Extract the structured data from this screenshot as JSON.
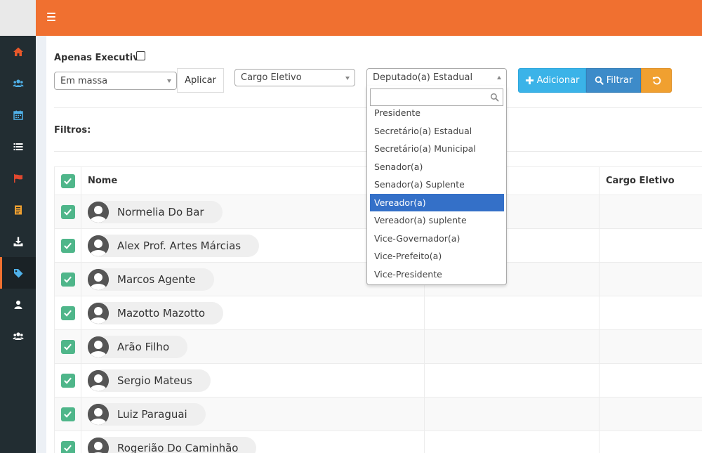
{
  "header": {
    "menu_icon": "hamburger-icon",
    "accent": "#f07030"
  },
  "sidebar": {
    "items": [
      {
        "icon": "home-icon",
        "color": "#e8582a"
      },
      {
        "icon": "users-icon",
        "color": "#4fb0e8"
      },
      {
        "icon": "calendar-icon",
        "color": "#4fb0e8"
      },
      {
        "icon": "list-icon",
        "color": "#ffffff"
      },
      {
        "icon": "flag-icon",
        "color": "#e0482f"
      },
      {
        "icon": "document-icon",
        "color": "#f0a030"
      },
      {
        "icon": "download-icon",
        "color": "#ffffff"
      },
      {
        "icon": "tag-icon",
        "color": "#4fb0e8",
        "active": true
      },
      {
        "icon": "user-icon",
        "color": "#ffffff"
      },
      {
        "icon": "group-icon",
        "color": "#ffffff"
      }
    ]
  },
  "toolbar": {
    "exec_label": "Apenas Executiva",
    "bulk_select": "Em massa",
    "apply_label": "Aplicar",
    "cargo_select": "Cargo Eletivo",
    "dep_select": "Deputado(a) Estadual",
    "add_label": "Adicionar",
    "filter_label": "Filtrar"
  },
  "filters_label": "Filtros:",
  "table": {
    "headers": {
      "name": "Nome",
      "cargo": "Cargo Eletivo"
    },
    "rows": [
      {
        "name": "Normelia Do Bar"
      },
      {
        "name": "Alex Prof. Artes Márcias"
      },
      {
        "name": "Marcos Agente"
      },
      {
        "name": "Mazotto Mazotto"
      },
      {
        "name": "Arão Filho"
      },
      {
        "name": "Sergio Mateus"
      },
      {
        "name": "Luiz Paraguai"
      },
      {
        "name": "Rogerião Do Caminhão"
      }
    ]
  },
  "dropdown": {
    "search_value": "",
    "options": [
      "Presidente",
      "Secretário(a) Estadual",
      "Secretário(a) Municipal",
      "Senador(a)",
      "Senador(a) Suplente",
      "Vereador(a)",
      "Vereador(a) suplente",
      "Vice-Governador(a)",
      "Vice-Prefeito(a)",
      "Vice-Presidente"
    ],
    "highlighted": "Vereador(a)"
  }
}
